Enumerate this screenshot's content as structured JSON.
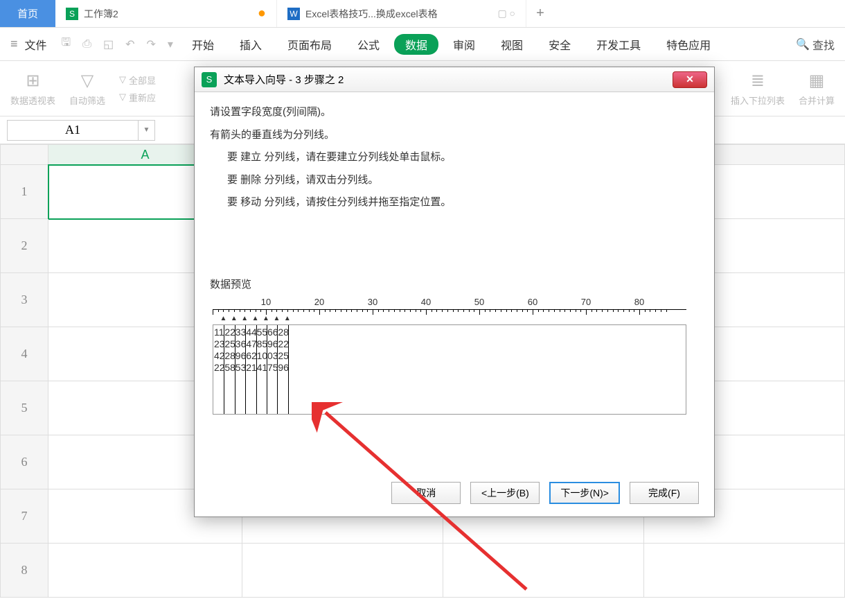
{
  "tabs": {
    "home": "首页",
    "wb_label": "工作簿2",
    "excel_label": "Excel表格技巧...换成excel表格"
  },
  "menu": {
    "file": "文件",
    "start": "开始",
    "insert": "插入",
    "page": "页面布局",
    "formula": "公式",
    "data": "数据",
    "review": "审阅",
    "view": "视图",
    "security": "安全",
    "dev": "开发工具",
    "special": "特色应用",
    "search": "查找"
  },
  "ribbon": {
    "pivot": "数据透视表",
    "filter": "自动筛选",
    "filter_all": "全部显",
    "refilter": "重新应",
    "insert_dd": "插入下拉列表",
    "merge": "合并计算"
  },
  "namebox": "A1",
  "cols": [
    "A"
  ],
  "rows": [
    "1",
    "2",
    "3",
    "4",
    "5",
    "6",
    "7",
    "8"
  ],
  "dialog": {
    "title": "文本导入向导 - 3 步骤之 2",
    "p1": "请设置字段宽度(列间隔)。",
    "p2": "有箭头的垂直线为分列线。",
    "p3": "要 建立 分列线，请在要建立分列线处单击鼠标。",
    "p4": "要 删除 分列线，请双击分列线。",
    "p5": "要 移动 分列线，请按住分列线并拖至指定位置。",
    "preview": "数据预览",
    "ruler_nums": [
      "10",
      "20",
      "30",
      "40",
      "50",
      "60",
      "70",
      "80"
    ],
    "breaks": [
      2,
      4,
      6,
      8,
      10,
      12,
      14
    ],
    "rowsdata": [
      [
        "11",
        "22",
        "33",
        "44",
        "55",
        "66",
        "28"
      ],
      [
        "23",
        "25",
        "36",
        "47",
        "85",
        "96",
        "22"
      ],
      [
        "42",
        "28",
        "96",
        "62",
        "10",
        "03",
        "25"
      ],
      [
        "22",
        "58",
        "53",
        "21",
        "41",
        "75",
        "96"
      ]
    ],
    "btn_cancel": "取消",
    "btn_back": "<上一步(B)",
    "btn_next": "下一步(N)>",
    "btn_finish": "完成(F)"
  }
}
